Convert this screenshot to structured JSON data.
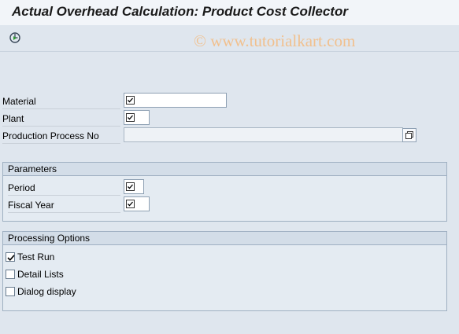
{
  "title": "Actual Overhead Calculation: Product Cost Collector",
  "watermark": "© www.tutorialkart.com",
  "toolbar": {
    "execute_icon": "execute-icon"
  },
  "fields": {
    "material": {
      "label": "Material",
      "value": "",
      "required": true
    },
    "plant": {
      "label": "Plant",
      "value": "",
      "required": true
    },
    "production_process": {
      "label": "Production Process No",
      "value": ""
    }
  },
  "parameters": {
    "header": "Parameters",
    "period": {
      "label": "Period",
      "value": "",
      "required": true
    },
    "fiscal_year": {
      "label": "Fiscal Year",
      "value": "",
      "required": true
    }
  },
  "processing": {
    "header": "Processing Options",
    "options": [
      {
        "label": "Test Run",
        "checked": true
      },
      {
        "label": "Detail Lists",
        "checked": false
      },
      {
        "label": "Dialog display",
        "checked": false
      }
    ]
  }
}
